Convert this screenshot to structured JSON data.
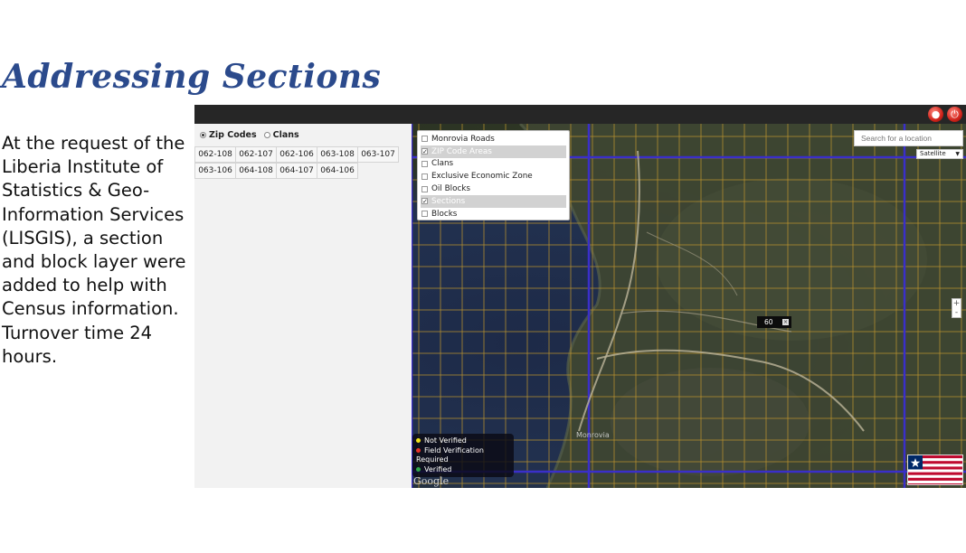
{
  "slide": {
    "title": "Addressing Sections",
    "body": "At the request of the Liberia Institute of Statistics & Geo-Information Services (LISGIS), a section and block layer were added to help with Census information. Turnover time 24 hours."
  },
  "left_panel": {
    "radio_options": [
      {
        "label": "Zip Codes",
        "selected": true
      },
      {
        "label": "Clans",
        "selected": false
      }
    ],
    "zip_codes": [
      [
        "062-108",
        "062-107",
        "062-106",
        "063-108",
        "063-107"
      ],
      [
        "063-106",
        "064-108",
        "064-107",
        "064-106"
      ]
    ]
  },
  "map": {
    "layers": [
      {
        "label": "Monrovia Roads",
        "checked": false,
        "selected": false
      },
      {
        "label": "ZIP Code Areas",
        "checked": true,
        "selected": true
      },
      {
        "label": "Clans",
        "checked": false,
        "selected": false
      },
      {
        "label": "Exclusive Economic Zone",
        "checked": false,
        "selected": false
      },
      {
        "label": "Oil Blocks",
        "checked": false,
        "selected": false
      },
      {
        "label": "Sections",
        "checked": true,
        "selected": true
      },
      {
        "label": "Blocks",
        "checked": false,
        "selected": false
      }
    ],
    "search_placeholder": "Search for a location",
    "basemap": "Satellite",
    "zoom_in": "+",
    "zoom_out": "-",
    "section_label": "60",
    "legend": [
      {
        "label": "Not Verified",
        "color": "#f2e21b"
      },
      {
        "label": "Field Verification Required",
        "color": "#e8322a"
      },
      {
        "label": "Verified",
        "color": "#2fa84a"
      }
    ],
    "attribution": "Google",
    "place_labels": [
      "Monrovia"
    ],
    "colors": {
      "grid_minor": "#b8912e",
      "grid_major": "#3a2fc9",
      "topbar": "#262626"
    }
  }
}
